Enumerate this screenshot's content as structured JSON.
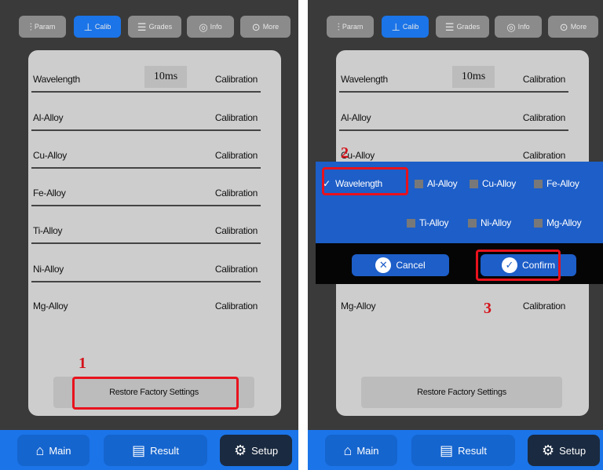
{
  "tabs": [
    {
      "label": "Param",
      "icon": "sliders-icon"
    },
    {
      "label": "Calib",
      "icon": "calibration-icon"
    },
    {
      "label": "Grades",
      "icon": "grades-icon"
    },
    {
      "label": "Info",
      "icon": "info-icon"
    },
    {
      "label": "More",
      "icon": "more-icon"
    }
  ],
  "active_tab": "Calib",
  "calibration_rows": [
    {
      "name": "Wavelength",
      "value": "10ms",
      "action": "Calibration"
    },
    {
      "name": "Al-Alloy",
      "action": "Calibration"
    },
    {
      "name": "Cu-Alloy",
      "action": "Calibration"
    },
    {
      "name": "Fe-Alloy",
      "action": "Calibration"
    },
    {
      "name": "Ti-Alloy",
      "action": "Calibration"
    },
    {
      "name": "Ni-Alloy",
      "action": "Calibration"
    },
    {
      "name": "Mg-Alloy",
      "action": "Calibration"
    }
  ],
  "restore_button": "Restore Factory Settings",
  "nav": {
    "main": "Main",
    "result": "Result",
    "setup": "Setup"
  },
  "dialog": {
    "options": [
      {
        "label": "Wavelength",
        "checked": true
      },
      {
        "label": "Al-Alloy",
        "checked": false
      },
      {
        "label": "Cu-Alloy",
        "checked": false
      },
      {
        "label": "Fe-Alloy",
        "checked": false
      },
      {
        "label": "Ti-Alloy",
        "checked": false
      },
      {
        "label": "Ni-Alloy",
        "checked": false
      },
      {
        "label": "Mg-Alloy",
        "checked": false
      }
    ],
    "cancel": "Cancel",
    "confirm": "Confirm"
  },
  "annotations": {
    "step1": "1",
    "step2": "2",
    "step3": "3"
  },
  "colors": {
    "accent": "#1b74e8",
    "highlight": "#e8121d",
    "panel": "#cdcdcd",
    "device_bg": "#3a3a3a"
  }
}
